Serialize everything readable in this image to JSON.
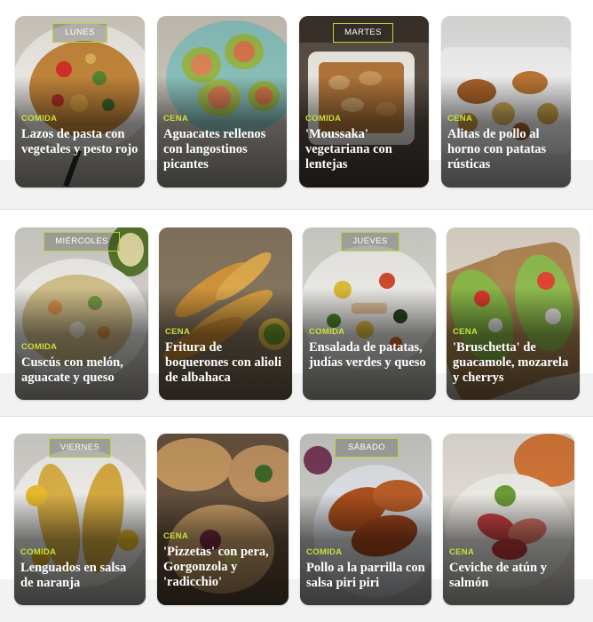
{
  "colors": {
    "category": "#c6e03a",
    "day_border": "#b9d43a",
    "title": "#ffffff"
  },
  "days": {
    "monday": "LUNES",
    "tuesday": "MARTES",
    "wednesday": "MIÉRCOLES",
    "thursday": "JUEVES",
    "friday": "VIERNES",
    "saturday": "SÁBADO"
  },
  "rows": [
    {
      "cards": [
        {
          "category": "COMIDA",
          "title": "Lazos de pasta con vegetales y pesto rojo"
        },
        {
          "category": "CENA",
          "title": "Aguacates rellenos con langostinos picantes"
        },
        {
          "category": "COMIDA",
          "title": "'Moussaka' vegetariana con lentejas"
        },
        {
          "category": "CENA",
          "title": "Alitas de pollo al horno con patatas rústicas"
        }
      ]
    },
    {
      "cards": [
        {
          "category": "COMIDA",
          "title": "Cuscús con melón, aguacate y queso"
        },
        {
          "category": "CENA",
          "title": "Fritura de boquerones con alioli de albahaca"
        },
        {
          "category": "COMIDA",
          "title": "Ensalada de patatas, judías verdes y queso"
        },
        {
          "category": "CENA",
          "title": "'Bruschetta' de guacamole, mozarela y cherrys"
        }
      ]
    },
    {
      "cards": [
        {
          "category": "COMIDA",
          "title": "Lenguados en salsa de naranja"
        },
        {
          "category": "CENA",
          "title": "'Pizzetas' con pera, Gorgonzola y 'radicchio'"
        },
        {
          "category": "COMIDA",
          "title": "Pollo a la parrilla con salsa piri piri"
        },
        {
          "category": "CENA",
          "title": "Ceviche de atún y salmón"
        }
      ]
    }
  ]
}
